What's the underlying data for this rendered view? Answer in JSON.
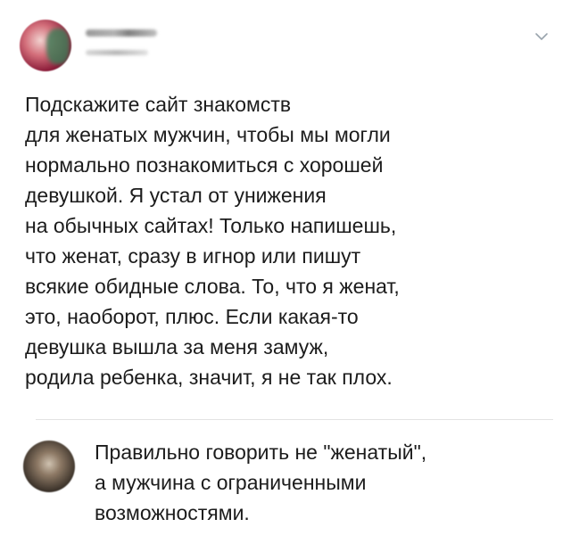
{
  "post": {
    "text": "Подскажите сайт знакомств\nдля женатых мужчин, чтобы мы могли\nнормально познакомиться с хорошей\nдевушкой. Я устал от унижения\nна обычных сайтах! Только напишешь,\nчто женат, сразу в игнор или пишут\nвсякие обидные слова. То, что я женат,\nэто, наоборот, плюс. Если какая-то\nдевушка вышла за меня замуж,\nродила ребенка, значит, я не так плох.",
    "menu_icon": "chevron-down-icon"
  },
  "comment": {
    "text": "Правильно говорить не \"женатый\",\nа мужчина с ограниченными\nвозможностями."
  },
  "colors": {
    "text": "#1c1c1c",
    "divider": "#e3e3e3",
    "chevron": "#9aa4ad"
  }
}
